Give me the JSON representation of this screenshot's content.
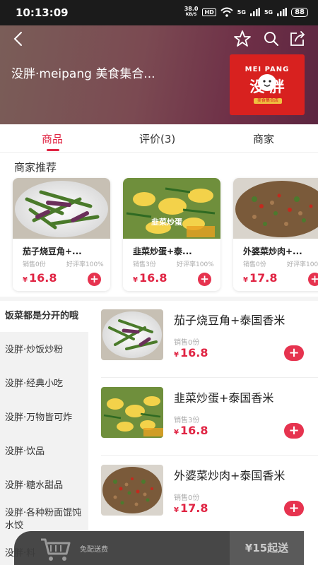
{
  "status": {
    "time": "10:13:09",
    "speed_value": "38.0",
    "speed_unit": "KB/S",
    "hd": "HD",
    "sig1": "5G",
    "sig2": "5G",
    "battery": "88"
  },
  "header": {
    "back_icon": "back-arrow-icon",
    "favorite_icon": "star-icon",
    "search_icon": "search-icon",
    "share_icon": "share-icon",
    "shop_name": "没胖·meipang 美食集合...",
    "logo_text_en": "MEI PANG",
    "logo_text_cn": "没 胖",
    "logo_sub": "美食集合店"
  },
  "tabs": [
    {
      "label": "商品",
      "active": true
    },
    {
      "label": "评价(3)",
      "active": false
    },
    {
      "label": "商家",
      "active": false
    }
  ],
  "recommend": {
    "title": "商家推荐",
    "items": [
      {
        "name": "茄子烧豆角+...",
        "sales": "销售0份",
        "rate": "好评率100%",
        "currency": "¥",
        "price": "16.8",
        "add": "+"
      },
      {
        "name": "韭菜炒蛋+泰...",
        "sales": "销售3份",
        "rate": "好评率100%",
        "currency": "¥",
        "price": "16.8",
        "add": "+"
      },
      {
        "name": "外婆菜炒肉+...",
        "sales": "销售0份",
        "rate": "好评率100%",
        "currency": "¥",
        "price": "17.8",
        "add": "+"
      }
    ]
  },
  "categories": [
    {
      "label": "饭菜都是分开的哦",
      "active": true
    },
    {
      "label": "没胖·炒饭炒粉",
      "active": false
    },
    {
      "label": "没胖·经典小吃",
      "active": false
    },
    {
      "label": "没胖·万物皆可炸",
      "active": false
    },
    {
      "label": "没胖·饮品",
      "active": false
    },
    {
      "label": "没胖·糖水甜品",
      "active": false
    },
    {
      "label": "没胖·各种粉面馄饨水饺",
      "active": false
    },
    {
      "label": "没胖·料",
      "active": false
    }
  ],
  "menu_items": [
    {
      "name": "茄子烧豆角+泰国香米",
      "sales": "销售0份",
      "currency": "¥",
      "price": "16.8",
      "add": "+"
    },
    {
      "name": "韭菜炒蛋+泰国香米",
      "sales": "销售3份",
      "currency": "¥",
      "price": "16.8",
      "add": "+"
    },
    {
      "name": "外婆菜炒肉+泰国香米",
      "sales": "销售0份",
      "currency": "¥",
      "price": "17.8",
      "add": "+"
    }
  ],
  "image_labels": {
    "egg": "韭菜炒蛋"
  },
  "cart": {
    "icon": "shopping-cart-icon",
    "delivery_text": "免配送费",
    "checkout_label": "¥15起送"
  },
  "colors": {
    "accent": "#e02443",
    "add_button": "#e6334f",
    "logo_red": "#d8211f"
  }
}
